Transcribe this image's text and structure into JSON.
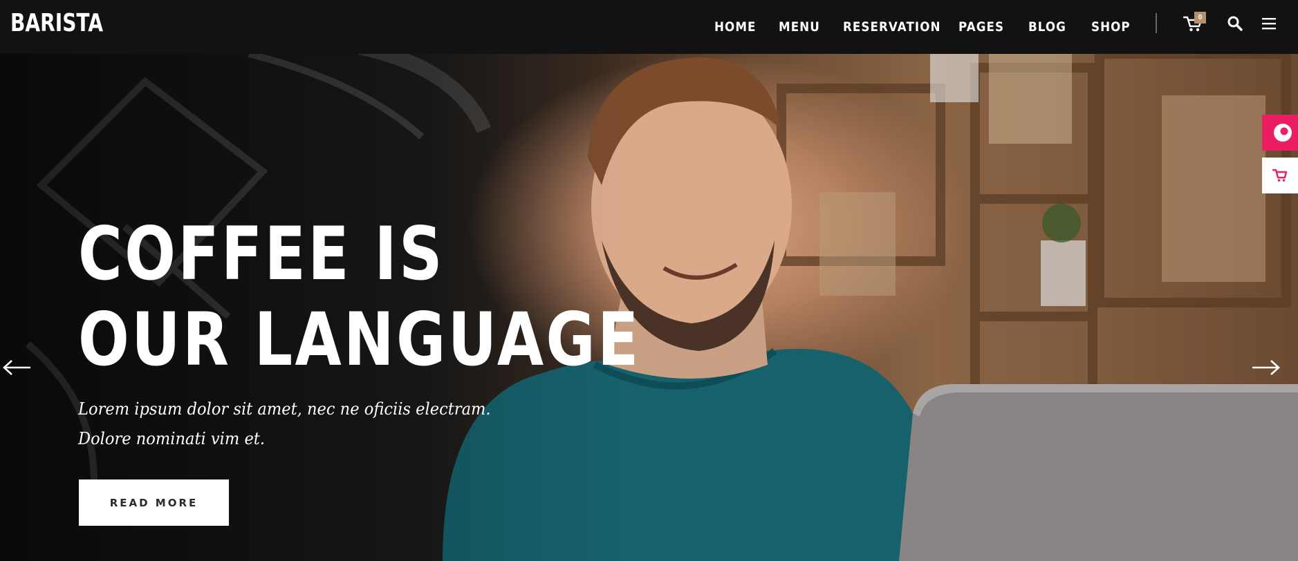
{
  "header": {
    "logo": "BARISTA",
    "nav": [
      "HOME",
      "MENU",
      "RESERVATION",
      "PAGES",
      "BLOG",
      "SHOP"
    ],
    "cart_count": "0",
    "icons": [
      "cart-icon",
      "search-icon",
      "hamburger-menu-icon"
    ]
  },
  "hero": {
    "title_line1": "COFFEE IS",
    "title_line2": "OUR LANGUAGE",
    "subtitle_line1": "Lorem ipsum dolor sit amet, nec ne oficiis electram.",
    "subtitle_line2": "Dolore nominati vim et.",
    "cta_label": "READ MORE",
    "prev_icon": "arrow-left-icon",
    "next_icon": "arrow-right-icon"
  },
  "side_widgets": [
    "support-chat-icon",
    "cart-icon"
  ],
  "colors": {
    "header_bg": "#121212",
    "badge": "#b7906f",
    "accent_pink": "#e91e63",
    "text": "#ffffff"
  }
}
